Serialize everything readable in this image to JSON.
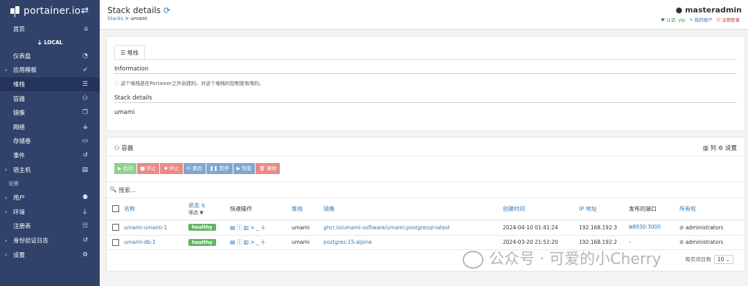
{
  "sidebar": {
    "brand": "portainer.io",
    "items": [
      {
        "label": "首页",
        "icon": "home-icon",
        "glyph": "⌂"
      },
      {
        "label": "仪表盘",
        "icon": "dashboard-icon",
        "glyph": "◔"
      },
      {
        "label": "应用模板",
        "icon": "rocket-icon",
        "glyph": "➶"
      },
      {
        "label": "堆栈",
        "icon": "list-icon",
        "glyph": "☰"
      },
      {
        "label": "容器",
        "icon": "cubes-icon",
        "glyph": "⚇"
      },
      {
        "label": "镜像",
        "icon": "clone-icon",
        "glyph": "❐"
      },
      {
        "label": "网络",
        "icon": "sitemap-icon",
        "glyph": "⚶"
      },
      {
        "label": "存储卷",
        "icon": "hdd-icon",
        "glyph": "▭"
      },
      {
        "label": "事件",
        "icon": "history-icon",
        "glyph": "↺"
      },
      {
        "label": "宿主机",
        "icon": "server-icon",
        "glyph": "▤"
      },
      {
        "label": "用户",
        "icon": "users-icon",
        "glyph": "⚉"
      },
      {
        "label": "环境",
        "icon": "plug-icon",
        "glyph": "⏚"
      },
      {
        "label": "注册表",
        "icon": "database-icon",
        "glyph": "☷"
      },
      {
        "label": "身份验证日志",
        "icon": "history-icon",
        "glyph": "↺"
      },
      {
        "label": "设置",
        "icon": "cogs-icon",
        "glyph": "⚙"
      }
    ],
    "local_label": "LOCAL",
    "settings_heading": "设置"
  },
  "topbar": {
    "title": "Stack details",
    "breadcrumb_root": "Stacks",
    "breadcrumb_sep": " > ",
    "breadcrumb_current": "umami",
    "username": "masteradmin",
    "link_support": "♥ 认证: yip",
    "link_account": "✎ 我的账户",
    "link_logout": "⏻ 注销登录"
  },
  "stack_panel": {
    "tab_label": "堆栈",
    "info_title": "Information",
    "info_text": "这个堆栈是在Portainer之外创建的。对这个堆栈的控制是有限的。",
    "details_title": "Stack details",
    "stack_name": "umami"
  },
  "containers_panel": {
    "title": "容器",
    "columns_label": "列",
    "settings_label": "设置",
    "buttons": [
      "启动",
      "停止",
      "终止",
      "重启",
      "暂停",
      "恢复",
      "删除"
    ],
    "search_placeholder": "搜索...",
    "headers": {
      "name": "名称",
      "state": "状态",
      "filter": "筛选",
      "quick_actions": "快速操作",
      "stack": "堆栈",
      "image": "镜像",
      "created": "创建时间",
      "ip": "IP 地址",
      "ports": "发布的端口",
      "ownership": "所有权"
    },
    "rows": [
      {
        "name": "umami-umami-1",
        "status": "healthy",
        "stack": "umami",
        "image": "ghcr.io/umami-software/umami:postgresql-latest",
        "created": "2024-04-10 01:41:24",
        "ip": "192.168.192.3",
        "ports": "8930:3000",
        "ownership": "administrators"
      },
      {
        "name": "umami-db-1",
        "status": "healthy",
        "stack": "umami",
        "image": "postgres:15-alpine",
        "created": "2024-03-20 21:52:20",
        "ip": "192.168.192.2",
        "ports": "-",
        "ownership": "administrators"
      }
    ],
    "items_per_page_label": "每页项目数",
    "items_per_page": "10"
  },
  "watermark": "公众号 · 可爱的小Cherry",
  "colors": {
    "sidebar": "#30426a",
    "link": "#337ab7",
    "healthy": "#5cb85c"
  }
}
